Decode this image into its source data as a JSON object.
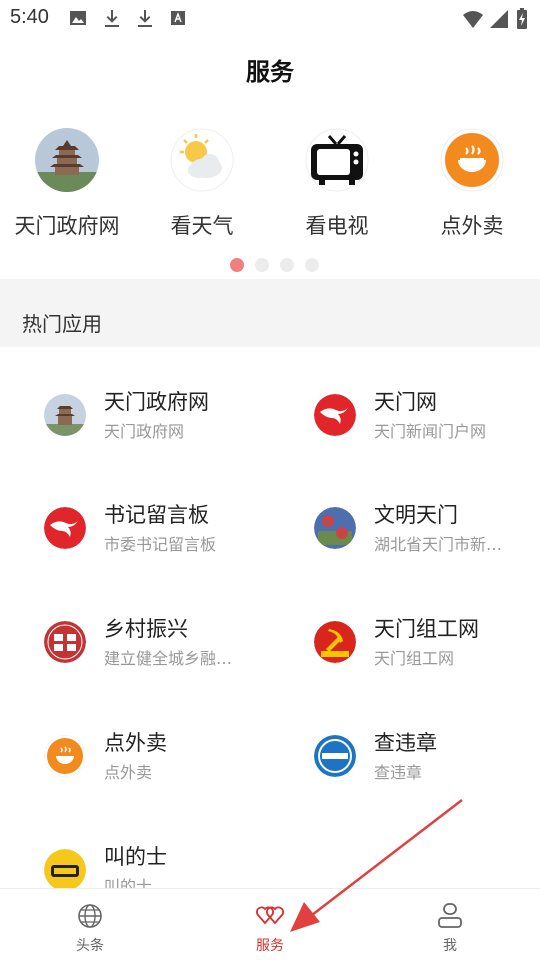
{
  "status_bar": {
    "time": "5:40"
  },
  "header": {
    "title": "服务"
  },
  "carousel": {
    "items": [
      {
        "label": "天门政府网",
        "icon": "pagoda-icon"
      },
      {
        "label": "看天气",
        "icon": "weather-icon"
      },
      {
        "label": "看电视",
        "icon": "tv-icon"
      },
      {
        "label": "点外卖",
        "icon": "food-bowl-icon"
      }
    ],
    "page_count": 4,
    "active_page": 1
  },
  "section": {
    "title": "热门应用"
  },
  "apps": [
    {
      "name": "天门政府网",
      "desc": "天门政府网",
      "icon": "pagoda-icon"
    },
    {
      "name": "天门网",
      "desc": "天门新闻门户网",
      "icon": "tianmen-logo-icon"
    },
    {
      "name": "书记留言板",
      "desc": "市委书记留言板",
      "icon": "tianmen-logo-icon"
    },
    {
      "name": "文明天门",
      "desc": "湖北省天门市新…",
      "icon": "wenming-icon"
    },
    {
      "name": "乡村振兴",
      "desc": "建立健全城乡融…",
      "icon": "rural-revival-icon"
    },
    {
      "name": "天门组工网",
      "desc": "天门组工网",
      "icon": "party-emblem-icon"
    },
    {
      "name": "点外卖",
      "desc": "点外卖",
      "icon": "food-bowl-icon"
    },
    {
      "name": "查违章",
      "desc": "查违章",
      "icon": "traffic-violation-icon"
    },
    {
      "name": "叫的士",
      "desc": "叫的士",
      "icon": "taxi-icon"
    }
  ],
  "bottom_nav": {
    "items": [
      {
        "label": "头条",
        "icon": "globe-icon"
      },
      {
        "label": "服务",
        "icon": "hearts-icon"
      },
      {
        "label": "我",
        "icon": "user-icon"
      }
    ],
    "active": "服务"
  },
  "colors": {
    "accent": "#d9302f",
    "section_bg": "#f4f4f4",
    "annotation_arrow": "#e04040"
  }
}
